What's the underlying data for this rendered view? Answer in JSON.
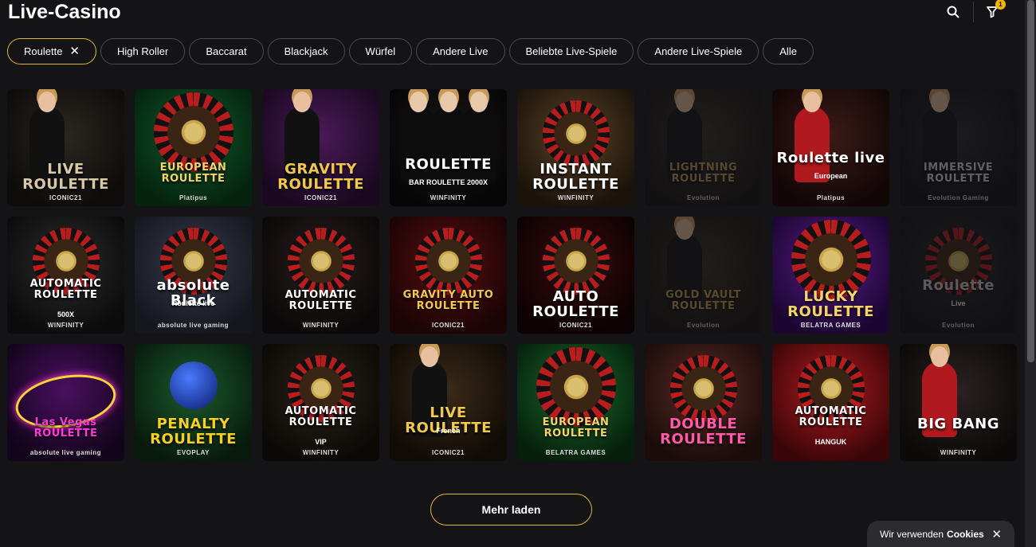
{
  "header": {
    "title": "Live-Casino",
    "cart_badge": "1"
  },
  "filters": [
    {
      "label": "Roulette",
      "active": true,
      "close": "✕"
    },
    {
      "label": "High Roller"
    },
    {
      "label": "Baccarat"
    },
    {
      "label": "Blackjack"
    },
    {
      "label": "Würfel"
    },
    {
      "label": "Andere Live"
    },
    {
      "label": "Beliebte Live-Spiele"
    },
    {
      "label": "Andere Live-Spiele"
    },
    {
      "label": "Alle"
    }
  ],
  "games": [
    {
      "title": "LIVE ROULETTE",
      "brand": "ICONIC21",
      "style": "person-dark",
      "colors": [
        "#2b2620",
        "#0d0c0a"
      ],
      "accent": "#d8c8a8"
    },
    {
      "title": "EUROPEAN ROULETTE",
      "brand": "Platipus",
      "style": "wheel-green",
      "colors": [
        "#0f5a2b",
        "#05230f"
      ],
      "accent": "#f4d46a"
    },
    {
      "title": "GRAVITY ROULETTE",
      "brand": "ICONIC21",
      "style": "person-purple",
      "colors": [
        "#4a1a58",
        "#1a0820"
      ],
      "accent": "#f2c84a"
    },
    {
      "title": "ROULETTE",
      "sub": "BAR ROULETTE 2000X",
      "brand": "WINFINITY",
      "style": "people-dark",
      "colors": [
        "#1a1616",
        "#070606"
      ],
      "accent": "#fff"
    },
    {
      "title": "INSTANT ROULETTE",
      "brand": "WINFINITY",
      "style": "wheel-brown",
      "colors": [
        "#5a4126",
        "#1b130a"
      ],
      "accent": "#fff"
    },
    {
      "title": "LIGHTNING ROULETTE",
      "brand": "Evolution",
      "style": "dim-person",
      "colors": [
        "#3a2f28",
        "#120e0b"
      ],
      "accent": "#c89c5a",
      "dim": true
    },
    {
      "title": "Roulette live",
      "sub": "European",
      "brand": "Platipus",
      "style": "person-red",
      "colors": [
        "#3a1b18",
        "#120606"
      ],
      "accent": "#fff"
    },
    {
      "title": "IMMERSIVE ROULETTE",
      "brand": "Evolution Gaming",
      "style": "dim-person",
      "colors": [
        "#2a2626",
        "#0c0a0a"
      ],
      "accent": "#ddd",
      "dim": true
    },
    {
      "title": "AUTOMATIC ROULETTE",
      "sub": "500X",
      "brand": "WINFINITY",
      "style": "wheel-black",
      "colors": [
        "#2c2c2c",
        "#0b0b0b"
      ],
      "accent": "#fff"
    },
    {
      "title": "absolute Black",
      "sub": "Roulette live",
      "brand": "absolute live gaming",
      "style": "wheel-blue",
      "colors": [
        "#353a4a",
        "#15171f"
      ],
      "accent": "#fff"
    },
    {
      "title": "AUTOMATIC ROULETTE",
      "brand": "WINFINITY",
      "style": "wheel-black",
      "colors": [
        "#2a1e1e",
        "#0a0808"
      ],
      "accent": "#fff"
    },
    {
      "title": "GRAVITY AUTO ROULETTE",
      "brand": "ICONIC21",
      "style": "wheel-red",
      "colors": [
        "#5a0e10",
        "#1a0405"
      ],
      "accent": "#f2c84a"
    },
    {
      "title": "AUTO ROULETTE",
      "brand": "ICONIC21",
      "style": "wheel-red",
      "colors": [
        "#3a0a0c",
        "#0c0203"
      ],
      "accent": "#fff"
    },
    {
      "title": "GOLD VAULT ROULETTE",
      "brand": "Evolution",
      "style": "dim-person",
      "colors": [
        "#3a2e22",
        "#120d09"
      ],
      "accent": "#c8a050",
      "dim": true
    },
    {
      "title": "LUCKY ROULETTE",
      "brand": "BELATRA GAMES",
      "style": "wheel-purple",
      "colors": [
        "#5a1a8a",
        "#1a0630"
      ],
      "accent": "#f4d46a"
    },
    {
      "title": "Roulette",
      "sub": "Live",
      "brand": "Evolution",
      "style": "dim-wheel",
      "colors": [
        "#2a2828",
        "#0e0d0d"
      ],
      "accent": "#ccc",
      "dim": true
    },
    {
      "title": "Las Vegas ROULETTE",
      "brand": "absolute live gaming",
      "style": "neon",
      "colors": [
        "#4a1060",
        "#12041a"
      ],
      "accent": "#ff3ad8"
    },
    {
      "title": "PENALTY ROULETTE",
      "brand": "EVOPLAY",
      "style": "ball",
      "colors": [
        "#1a5a2a",
        "#081a0e"
      ],
      "accent": "#f4d020"
    },
    {
      "title": "AUTOMATIC ROULETTE",
      "sub": "VIP",
      "brand": "WINFINITY",
      "style": "wheel-black",
      "colors": [
        "#2a2218",
        "#0b0906"
      ],
      "accent": "#fff"
    },
    {
      "title": "LIVE ROULETTE",
      "sub": "French",
      "brand": "ICONIC21",
      "style": "person-dark",
      "colors": [
        "#3a2a18",
        "#100b06"
      ],
      "accent": "#f2c84a"
    },
    {
      "title": "EUROPEAN ROULETTE",
      "brand": "BELATRA GAMES",
      "style": "wheel-green",
      "colors": [
        "#1a6a2a",
        "#06200c"
      ],
      "accent": "#f4d46a"
    },
    {
      "title": "DOUBLE ROULETTE",
      "brand": "",
      "style": "wheel-dark",
      "colors": [
        "#5a2a26",
        "#1a0c0a"
      ],
      "accent": "#ff5aa8"
    },
    {
      "title": "AUTOMATIC ROULETTE",
      "sub": "HANGUK",
      "brand": "",
      "style": "wheel-red",
      "colors": [
        "#b01a1e",
        "#3a0608"
      ],
      "accent": "#fff"
    },
    {
      "title": "BIG BANG",
      "brand": "WINFINITY",
      "style": "person-red",
      "colors": [
        "#2a2222",
        "#0c0909"
      ],
      "accent": "#fff"
    }
  ],
  "more_label": "Mehr laden",
  "cookie": {
    "text": "Wir verwenden",
    "bold": "Cookies",
    "close": "✕"
  },
  "colors": {
    "bg": "#141416",
    "accent": "#e2b52b",
    "chip_border": "#4a4a50"
  }
}
